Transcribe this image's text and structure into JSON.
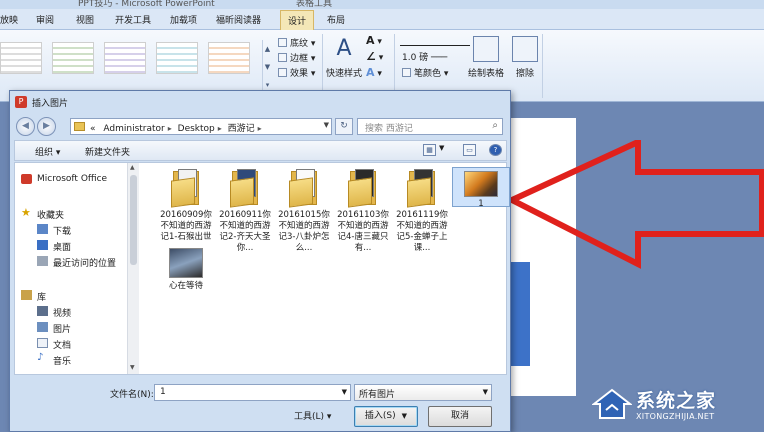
{
  "titlebar": {
    "partial_left": "PPT技巧 - Microsoft PowerPoint",
    "partial_center": "表格工具"
  },
  "ribbon_tabs": [
    "放映",
    "审阅",
    "视图",
    "开发工具",
    "加载项",
    "福昕阅读器",
    "设计",
    "布局"
  ],
  "ribbon": {
    "shading": "底纹",
    "border": "边框",
    "effects": "效果",
    "quick_styles": "快速样式",
    "pen_weight": "1.0 磅",
    "pen_color": "笔颜色",
    "draw_table": "绘制表格",
    "eraser": "擦除"
  },
  "dialog": {
    "title": "插入图片",
    "address": [
      "Administrator",
      "Desktop",
      "西游记"
    ],
    "address_prefix": "«",
    "search_placeholder": "搜索 西游记",
    "toolbar": {
      "organize": "组织",
      "new_folder": "新建文件夹"
    },
    "nav": [
      {
        "label": "Microsoft Office",
        "icon": "office-icon"
      },
      {
        "label": "收藏夹",
        "icon": "star-icon"
      },
      {
        "label": "下载",
        "icon": "download-folder-icon"
      },
      {
        "label": "桌面",
        "icon": "desktop-icon"
      },
      {
        "label": "最近访问的位置",
        "icon": "recent-places-icon"
      },
      {
        "label": "库",
        "icon": "library-icon"
      },
      {
        "label": "视频",
        "icon": "video-icon"
      },
      {
        "label": "图片",
        "icon": "pictures-icon"
      },
      {
        "label": "文档",
        "icon": "documents-icon"
      },
      {
        "label": "音乐",
        "icon": "music-icon"
      }
    ],
    "files": [
      {
        "name": "20160909你不知道的西游记1-石猴出世",
        "type": "folder"
      },
      {
        "name": "20160911你不知道的西游记2-齐天大圣你...",
        "type": "folder"
      },
      {
        "name": "20161015你不知道的西游记3-八卦炉怎么...",
        "type": "folder"
      },
      {
        "name": "20161103你不知道的西游记4-唐三藏只有...",
        "type": "folder"
      },
      {
        "name": "20161119你不知道的西游记5-金蝉子上课...",
        "type": "folder"
      },
      {
        "name": "1",
        "type": "image",
        "selected": true
      },
      {
        "name": "心在等待",
        "type": "image"
      }
    ],
    "filename_label": "文件名(N):",
    "filename_value": "1",
    "filetype_value": "所有图片",
    "tools_label": "工具(L)",
    "insert_label": "插入(S)",
    "cancel_label": "取消"
  },
  "watermark": {
    "title": "系统之家",
    "subtitle": "XITONGZHIJIA.NET"
  },
  "colors": {
    "arrow": "#e0211c",
    "ribbon_active": "#f4e7b7",
    "dialog_bg": "#cfdff2"
  }
}
